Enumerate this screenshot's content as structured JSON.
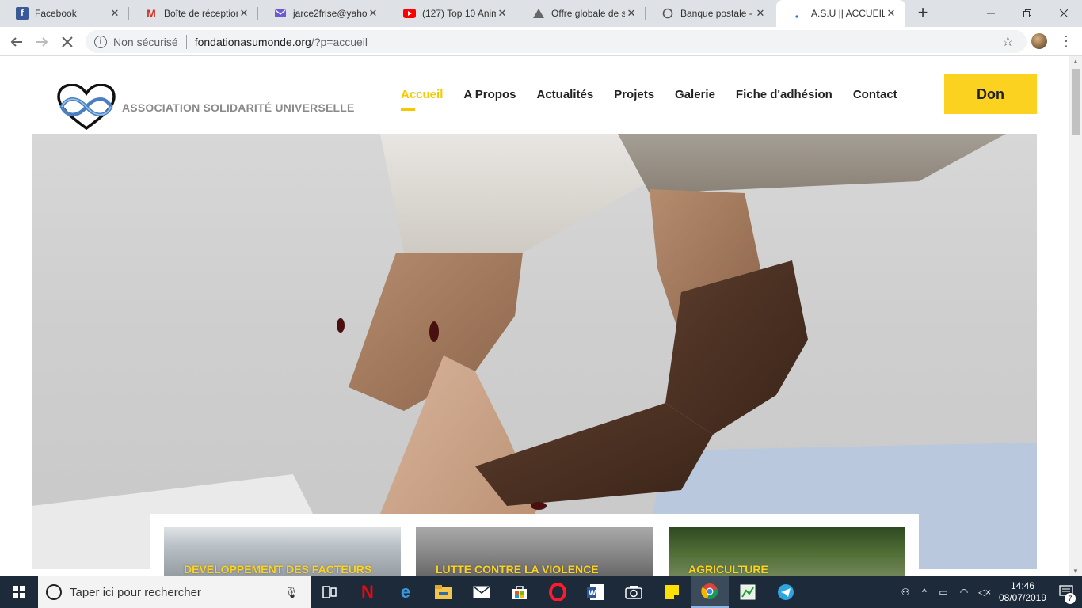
{
  "browser": {
    "tabs": [
      {
        "title": "Facebook",
        "icon": "facebook-icon",
        "color": "#3b5998"
      },
      {
        "title": "Boîte de réception",
        "icon": "gmail-icon",
        "color": "#d93025"
      },
      {
        "title": "jarce2frise@yahoo",
        "icon": "yahoo-mail-icon",
        "color": "#6b5bd2"
      },
      {
        "title": "(127) Top 10 Anim",
        "icon": "youtube-icon",
        "color": "#ff0000"
      },
      {
        "title": "Offre globale de s",
        "icon": "triangle-site-icon",
        "color": "#666666"
      },
      {
        "title": "Banque postale - C",
        "icon": "loading-icon",
        "color": "#555555"
      },
      {
        "title": "A.S.U || ACCUEIL",
        "icon": "loading-dot-icon",
        "color": "#1a73e8"
      }
    ],
    "close_glyph": "✕",
    "new_tab_glyph": "+",
    "address": {
      "security_label": "Non sécurisé",
      "host": "fondationasumonde.org",
      "path": "/?p=accueil"
    }
  },
  "site": {
    "logo_text": "ASSOCIATION SOLIDARITÉ UNIVERSELLE",
    "menu": [
      "Accueil",
      "A Propos",
      "Actualités",
      "Projets",
      "Galerie",
      "Fiche d'adhésion",
      "Contact"
    ],
    "active_menu_index": 0,
    "donate_label": "Don",
    "accent_color": "#fcd220",
    "slider": {
      "count": 3,
      "active_index": 1
    },
    "cards": [
      {
        "title": "DÉVELOPPEMENT DES FACTEURS"
      },
      {
        "title": "LUTTE CONTRE LA VIOLENCE"
      },
      {
        "title": "AGRICULTURE"
      }
    ]
  },
  "taskbar": {
    "search_placeholder": "Taper ici pour rechercher",
    "apps": [
      "task-view-icon",
      "netflix-icon",
      "edge-icon",
      "file-explorer-icon",
      "mail-icon",
      "store-icon",
      "opera-icon",
      "word-icon",
      "camera-icon",
      "sticky-notes-icon",
      "chrome-icon",
      "spreadsheet-icon",
      "telegram-icon"
    ],
    "active_app": "chrome-icon",
    "time": "14:46",
    "date": "08/07/2019",
    "notification_count": "7"
  }
}
